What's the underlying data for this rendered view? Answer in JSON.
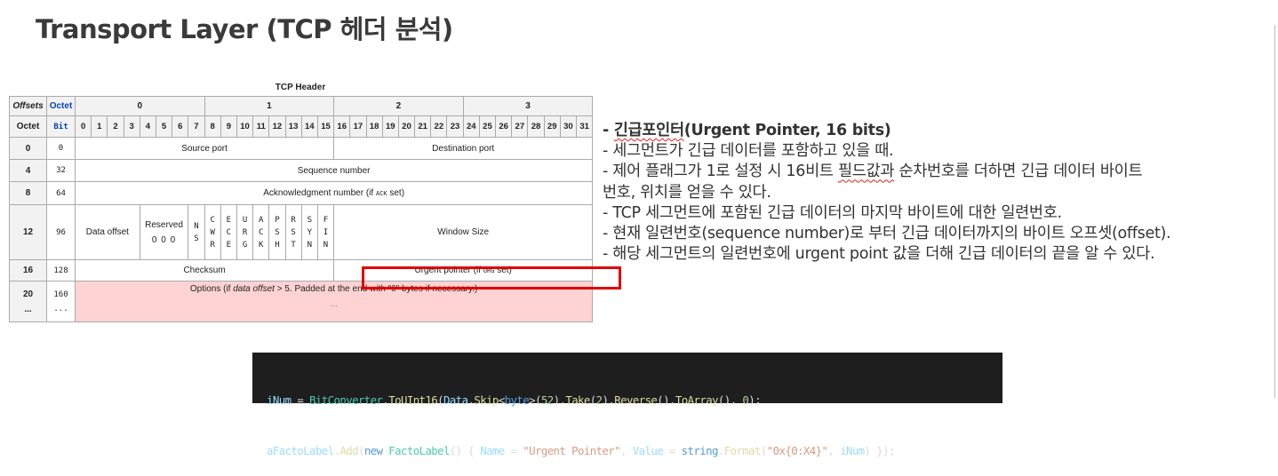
{
  "title": "Transport Layer (TCP 헤더 분석)",
  "tcp_header": {
    "caption": "TCP Header",
    "offsets_label": "Offsets",
    "octet_label": "Octet",
    "bit_label": "Bit",
    "octets": [
      "0",
      "1",
      "2",
      "3"
    ],
    "bits": [
      "0",
      "1",
      "2",
      "3",
      "4",
      "5",
      "6",
      "7",
      "8",
      "9",
      "10",
      "11",
      "12",
      "13",
      "14",
      "15",
      "16",
      "17",
      "18",
      "19",
      "20",
      "21",
      "22",
      "23",
      "24",
      "25",
      "26",
      "27",
      "28",
      "29",
      "30",
      "31"
    ],
    "rows": [
      {
        "octet": "0",
        "bit": "0"
      },
      {
        "octet": "4",
        "bit": "32"
      },
      {
        "octet": "8",
        "bit": "64"
      },
      {
        "octet": "12",
        "bit": "96"
      },
      {
        "octet": "16",
        "bit": "128"
      },
      {
        "octet": "20",
        "octet2": "...",
        "bit": "160",
        "bit2": "..."
      }
    ],
    "fields": {
      "source_port": "Source port",
      "destination_port": "Destination port",
      "sequence_number": "Sequence number",
      "ack_pre": "Acknowledgment number (if ",
      "ack_code": "ACK",
      "ack_post": " set)",
      "data_offset": "Data offset",
      "reserved": "Reserved",
      "reserved_bits": "0 0 0",
      "flags": [
        {
          "id": "ns",
          "chars": [
            "N",
            "S"
          ]
        },
        {
          "id": "cwr",
          "chars": [
            "C",
            "W",
            "R"
          ]
        },
        {
          "id": "ece",
          "chars": [
            "E",
            "C",
            "E"
          ]
        },
        {
          "id": "urg",
          "chars": [
            "U",
            "R",
            "G"
          ]
        },
        {
          "id": "ack",
          "chars": [
            "A",
            "C",
            "K"
          ]
        },
        {
          "id": "psh",
          "chars": [
            "P",
            "S",
            "H"
          ]
        },
        {
          "id": "rst",
          "chars": [
            "R",
            "S",
            "T"
          ]
        },
        {
          "id": "syn",
          "chars": [
            "S",
            "Y",
            "N"
          ]
        },
        {
          "id": "fin",
          "chars": [
            "F",
            "I",
            "N"
          ]
        }
      ],
      "window_size": "Window Size",
      "checksum": "Checksum",
      "urgent_pre": "Urgent pointer (if ",
      "urgent_code": "URG",
      "urgent_post": " set)",
      "options_pre": "Options (if ",
      "options_italic": "data offset",
      "options_post": " > 5. Padded at the end with \"0\" bytes if necessary.)",
      "options_more": "..."
    }
  },
  "notes": {
    "heading_korean": "긴급포인터",
    "heading_rest": "(Urgent Pointer, 16 bits)",
    "line1": "- 세그먼트가 긴급 데이터를 포함하고 있을 때.",
    "line2_a": "- 제어 플래그가 1로 설정 시 16비트 ",
    "line2_b": "필드값과",
    "line2_c": " 순차번호를 더하면 긴급 데이터 바이트",
    "line3": "번호, 위치를 얻을 수 있다.",
    "line4": "- TCP 세그먼트에 포함된 긴급 데이터의 마지막 바이트에 대한 일련번호.",
    "line5": "- 현재 일련번호(sequence number)로 부터 긴급 데이터까지의 바이트 오프셋(offset).",
    "line6": "- 해당 세그먼트의 일련번호에 urgent point 값을 더해 긴급 데이터의 끝을 알 수 있다."
  },
  "code": {
    "line1": [
      {
        "t": "iNum",
        "c": "var"
      },
      {
        "t": " = ",
        "c": "op"
      },
      {
        "t": "BitConverter",
        "c": "type"
      },
      {
        "t": ".",
        "c": "op"
      },
      {
        "t": "ToUInt16",
        "c": "meth"
      },
      {
        "t": "(",
        "c": "op"
      },
      {
        "t": "Data",
        "c": "var"
      },
      {
        "t": ".",
        "c": "op"
      },
      {
        "t": "Skip",
        "c": "meth"
      },
      {
        "t": "<",
        "c": "op"
      },
      {
        "t": "byte",
        "c": "kw"
      },
      {
        "t": ">(",
        "c": "op"
      },
      {
        "t": "52",
        "c": "num"
      },
      {
        "t": ").",
        "c": "op"
      },
      {
        "t": "Take",
        "c": "meth"
      },
      {
        "t": "(",
        "c": "op"
      },
      {
        "t": "2",
        "c": "num"
      },
      {
        "t": ").",
        "c": "op"
      },
      {
        "t": "Reverse",
        "c": "meth"
      },
      {
        "t": "().",
        "c": "op"
      },
      {
        "t": "ToArray",
        "c": "meth"
      },
      {
        "t": "(), ",
        "c": "op"
      },
      {
        "t": "0",
        "c": "num"
      },
      {
        "t": ");",
        "c": "op"
      }
    ],
    "line2": [
      {
        "t": "aFactoLabel",
        "c": "var"
      },
      {
        "t": ".",
        "c": "op"
      },
      {
        "t": "Add",
        "c": "meth"
      },
      {
        "t": "(",
        "c": "op"
      },
      {
        "t": "new",
        "c": "kw"
      },
      {
        "t": " ",
        "c": "op"
      },
      {
        "t": "FactoLabel",
        "c": "type"
      },
      {
        "t": "() { ",
        "c": "op"
      },
      {
        "t": "Name",
        "c": "var"
      },
      {
        "t": " = ",
        "c": "op"
      },
      {
        "t": "\"Urgent Pointer\"",
        "c": "str"
      },
      {
        "t": ", ",
        "c": "op"
      },
      {
        "t": "Value",
        "c": "var"
      },
      {
        "t": " = ",
        "c": "op"
      },
      {
        "t": "string",
        "c": "kw"
      },
      {
        "t": ".",
        "c": "op"
      },
      {
        "t": "Format",
        "c": "meth"
      },
      {
        "t": "(",
        "c": "op"
      },
      {
        "t": "\"0x{0:X4}\"",
        "c": "str"
      },
      {
        "t": ", ",
        "c": "op"
      },
      {
        "t": "iNum",
        "c": "var"
      },
      {
        "t": ") });",
        "c": "op"
      }
    ]
  }
}
